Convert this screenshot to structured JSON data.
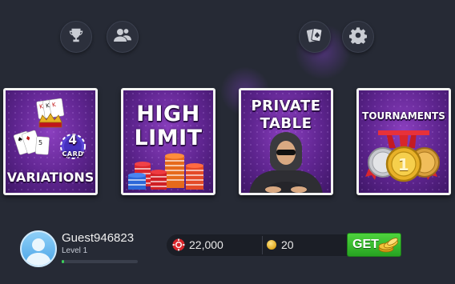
{
  "top_bar": {
    "left_icons": [
      "trophy-icon",
      "friends-icon"
    ],
    "right_icons": [
      "cards-icon",
      "gear-icon"
    ]
  },
  "game_modes": [
    {
      "name": "variations",
      "badge_number": "4",
      "badge_word": "CARD",
      "title": "VARIATIONS"
    },
    {
      "name": "high-limit",
      "line1": "HIGH",
      "line2": "LIMIT"
    },
    {
      "name": "private-table",
      "line1": "PRIVATE",
      "line2": "TABLE"
    },
    {
      "name": "tournaments",
      "title": "TOURNAMENTS",
      "medal_number": "1"
    }
  ],
  "player": {
    "username": "Guest946823",
    "level": "Level 1",
    "xp_progress": 0.03
  },
  "wallet": {
    "chips": "22,000",
    "coins": "20",
    "get_label": "GET"
  },
  "colors": {
    "background": "#262a35",
    "tile_purple": "#6a2a9c",
    "get_green": "#3cc52f",
    "chip_red": "#d8262b",
    "coin_gold": "#e8b128"
  }
}
